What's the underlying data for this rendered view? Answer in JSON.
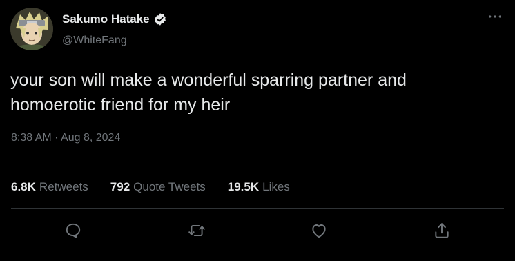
{
  "author": {
    "display_name": "Sakumo Hatake",
    "handle": "@WhiteFang",
    "verified_icon": "verified-badge-icon",
    "avatar": "avatar-image"
  },
  "tweet": {
    "text": "your son will make a wonderful sparring partner and\nhomoerotic friend for my heir",
    "timestamp": "8:38 AM · Aug 8, 2024"
  },
  "stats": {
    "retweets_count": "6.8K",
    "retweets_label": "Retweets",
    "quotes_count": "792",
    "quotes_label": "Quote Tweets",
    "likes_count": "19.5K",
    "likes_label": "Likes"
  },
  "actions": [
    "reply-icon",
    "retweet-icon",
    "like-icon",
    "share-icon"
  ],
  "colors": {
    "background": "#000000",
    "text_primary": "#e7e9ea",
    "text_secondary": "#71767b",
    "divider": "#2f3336"
  }
}
